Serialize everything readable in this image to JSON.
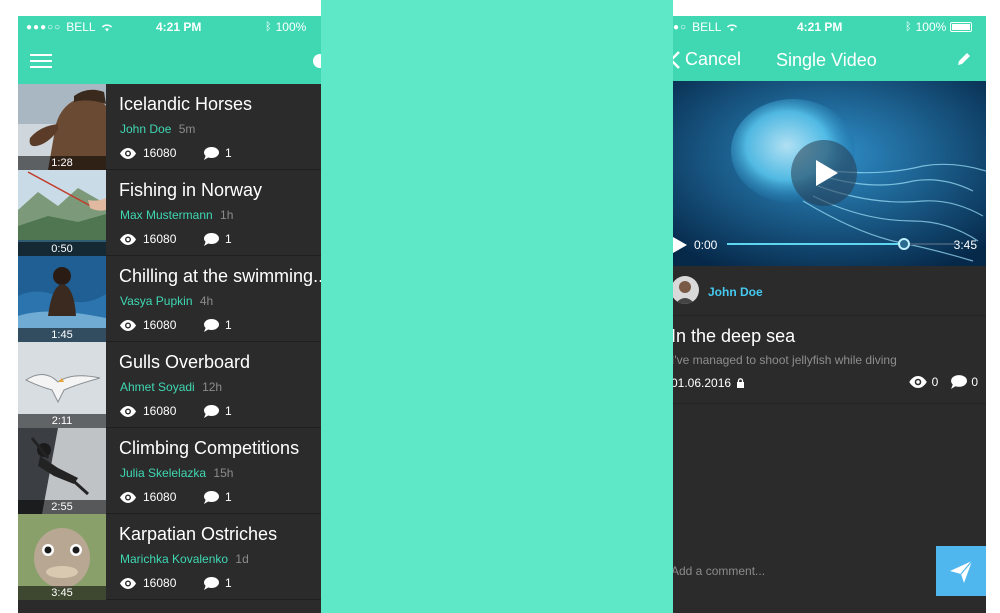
{
  "status_bar": {
    "carrier": "BELL",
    "time": "4:21 PM",
    "battery": "100%"
  },
  "left_screen": {
    "videos": [
      {
        "title": "Icelandic Horses",
        "author": "John Doe",
        "time_ago": "5m",
        "views": "16080",
        "comments": "1",
        "duration": "1:28"
      },
      {
        "title": "Fishing in Norway",
        "author": "Max Mustermann",
        "time_ago": "1h",
        "views": "16080",
        "comments": "1",
        "duration": "0:50"
      },
      {
        "title": "Chilling at the swimming...",
        "author": "Vasya Pupkin",
        "time_ago": "4h",
        "views": "16080",
        "comments": "1",
        "duration": "1:45"
      },
      {
        "title": "Gulls Overboard",
        "author": "Ahmet Soyadi",
        "time_ago": "12h",
        "views": "16080",
        "comments": "1",
        "duration": "2:11"
      },
      {
        "title": "Climbing Competitions",
        "author": "Julia Skelelazka",
        "time_ago": "15h",
        "views": "16080",
        "comments": "1",
        "duration": "2:55"
      },
      {
        "title": "Karpatian Ostriches",
        "author": "Marichka Kovalenko",
        "time_ago": "1d",
        "views": "16080",
        "comments": "1",
        "duration": "3:45"
      }
    ]
  },
  "right_screen": {
    "nav": {
      "back_label": "Cancel",
      "title": "Single Video"
    },
    "player": {
      "current_time": "0:00",
      "duration": "3:45",
      "progress": 0.77
    },
    "author": "John Doe",
    "video_title": "In the deep sea",
    "description": "I've managed to shoot jellyfish while diving",
    "date": "01.06.2016",
    "views": "0",
    "comments": "0",
    "comment_placeholder": "Add a comment..."
  },
  "colors": {
    "accent": "#3fd8b3",
    "middle_panel": "#5ee8c8",
    "background": "#2b2b2b",
    "link_blue": "#45c9f0",
    "send_button": "#4fb6ee"
  }
}
